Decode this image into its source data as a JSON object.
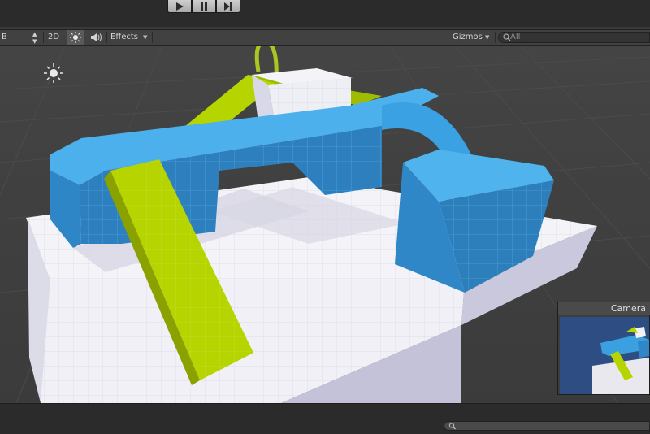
{
  "toolbar": {
    "shading_mode": "B",
    "mode_2d": "2D",
    "effects_label": "Effects",
    "gizmos_label": "Gizmos",
    "search_placeholder": "All"
  },
  "playback": {
    "play_icon": "play-icon",
    "pause_icon": "pause-icon",
    "step_icon": "step-icon"
  },
  "camera_preview": {
    "title": "Camera"
  },
  "colors": {
    "blue_mesh": "#3a9bd8",
    "green_ramp": "#b6d400",
    "white_floor": "#f2f2f6",
    "sky_preview": "#2d4d83"
  }
}
